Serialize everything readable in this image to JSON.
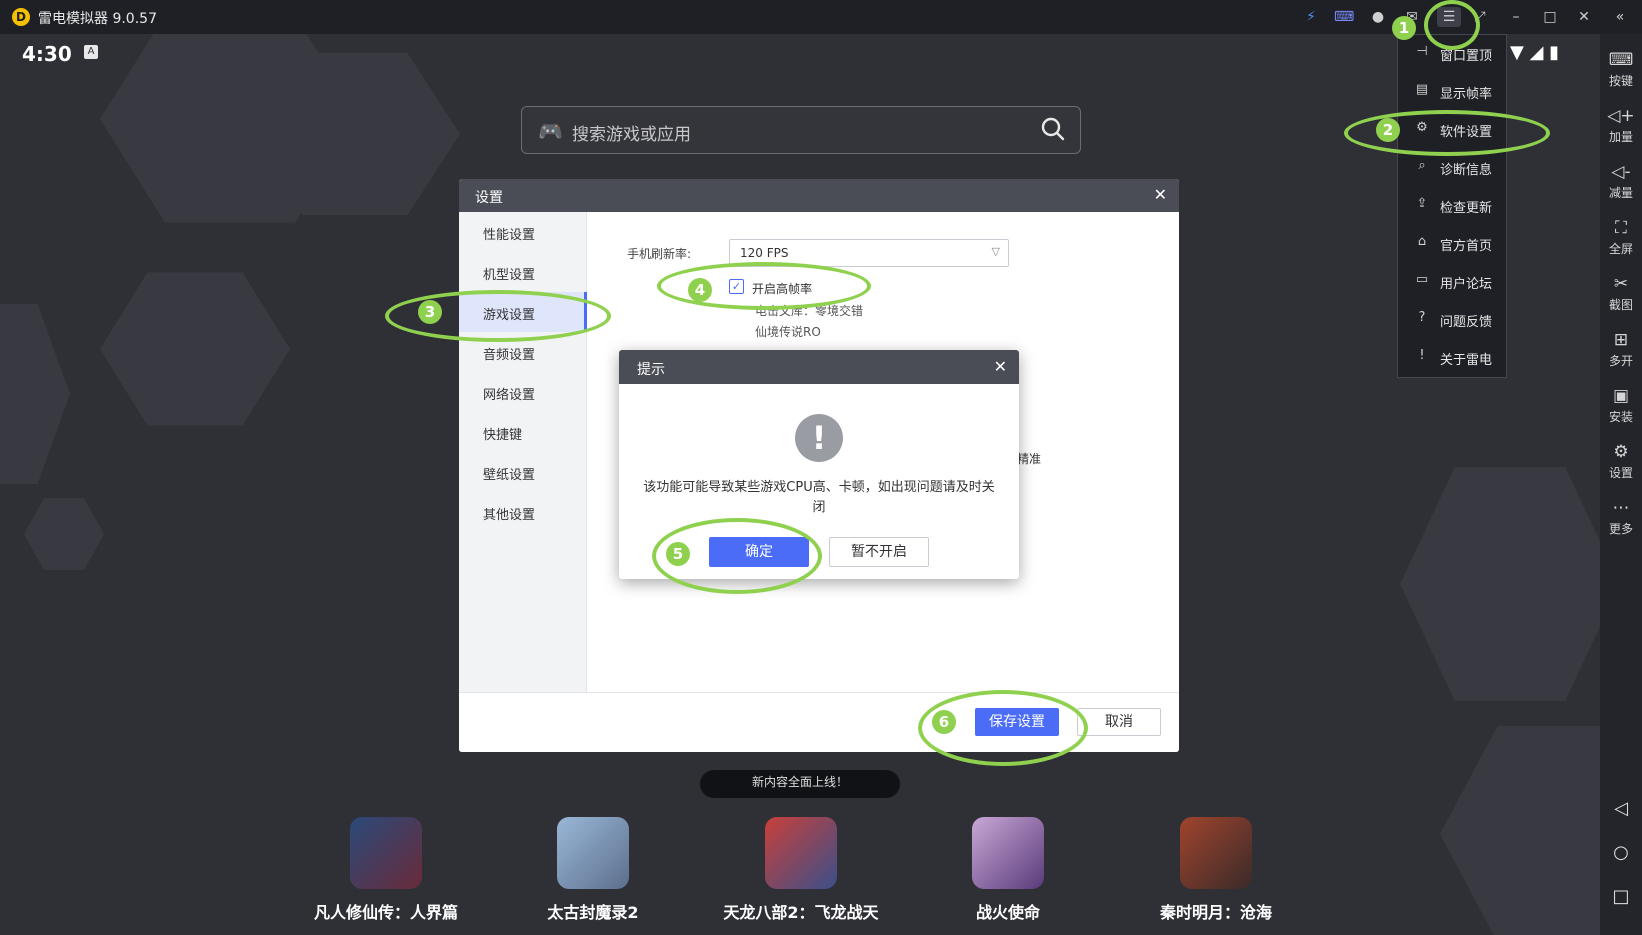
{
  "window": {
    "title": "雷电模拟器 9.0.57",
    "logo_text": "D",
    "toolbar_icons": [
      "bolt-icon",
      "gamepad-icon",
      "user-icon",
      "mail-icon",
      "menu-icon",
      "expand-icon",
      "minimize-icon",
      "maximize-icon",
      "close-icon",
      "collapse-sidebar-icon"
    ]
  },
  "statusbar": {
    "time": "4:30",
    "badge": "A"
  },
  "search": {
    "placeholder": "搜索游戏或应用"
  },
  "dropdown_menu": {
    "items": [
      {
        "icon": "pin-icon",
        "label": "窗口置顶"
      },
      {
        "icon": "fps-icon",
        "label": "显示帧率"
      },
      {
        "icon": "gear-icon",
        "label": "软件设置"
      },
      {
        "icon": "search-icon",
        "label": "诊断信息"
      },
      {
        "icon": "upload-icon",
        "label": "检查更新"
      },
      {
        "icon": "home-icon",
        "label": "官方首页"
      },
      {
        "icon": "chat-icon",
        "label": "用户论坛"
      },
      {
        "icon": "help-icon",
        "label": "问题反馈"
      },
      {
        "icon": "info-icon",
        "label": "关于雷电"
      }
    ]
  },
  "right_sidebar": {
    "items": [
      {
        "icon": "keyboard-icon",
        "label": "按键"
      },
      {
        "icon": "volume-up-icon",
        "label": "加量"
      },
      {
        "icon": "volume-down-icon",
        "label": "减量"
      },
      {
        "icon": "fullscreen-icon",
        "label": "全屏"
      },
      {
        "icon": "scissors-icon",
        "label": "截图"
      },
      {
        "icon": "multi-open-icon",
        "label": "多开"
      },
      {
        "icon": "apk-icon",
        "label": "安装"
      },
      {
        "icon": "gear-icon",
        "label": "设置"
      },
      {
        "icon": "more-icon",
        "label": "更多"
      }
    ],
    "nav_buttons": [
      "back-icon",
      "home-circle-icon",
      "recents-icon"
    ]
  },
  "settings_dialog": {
    "title": "设置",
    "nav": [
      {
        "label": "性能设置",
        "active": false
      },
      {
        "label": "机型设置",
        "active": false
      },
      {
        "label": "游戏设置",
        "active": true
      },
      {
        "label": "音频设置",
        "active": false
      },
      {
        "label": "网络设置",
        "active": false
      },
      {
        "label": "快捷键",
        "active": false
      },
      {
        "label": "壁纸设置",
        "active": false
      },
      {
        "label": "其他设置",
        "active": false
      }
    ],
    "refresh_label": "手机刷新率:",
    "refresh_value": "120 FPS",
    "high_fps_checkbox": {
      "label": "开启高帧率",
      "checked": true
    },
    "game_list": [
      "电击文库：零境交错",
      "仙境传说RO"
    ],
    "precise_text": "精准",
    "save_button": "保存设置",
    "cancel_button": "取消"
  },
  "prompt_dialog": {
    "title": "提示",
    "message": "该功能可能导致某些游戏CPU高、卡顿，如出现问题请及时关闭",
    "confirm_button": "确定",
    "decline_button": "暂不开启"
  },
  "dock": {
    "tooltip": "新内容全面上线！",
    "apps": [
      {
        "label": "凡人修仙传：人界篇",
        "color": "#2a4a7a"
      },
      {
        "label": "太古封魔录2",
        "color": "#9ab7d8"
      },
      {
        "label": "天龙八部2：飞龙战天",
        "color": "#3b4f8a"
      },
      {
        "label": "战火使命",
        "color": "#c9a7d6"
      },
      {
        "label": "秦时明月：沧海",
        "color": "#a0442c"
      }
    ]
  },
  "annotations": {
    "steps": [
      "1",
      "2",
      "3",
      "4",
      "5",
      "6"
    ],
    "color": "#8fd14f"
  }
}
